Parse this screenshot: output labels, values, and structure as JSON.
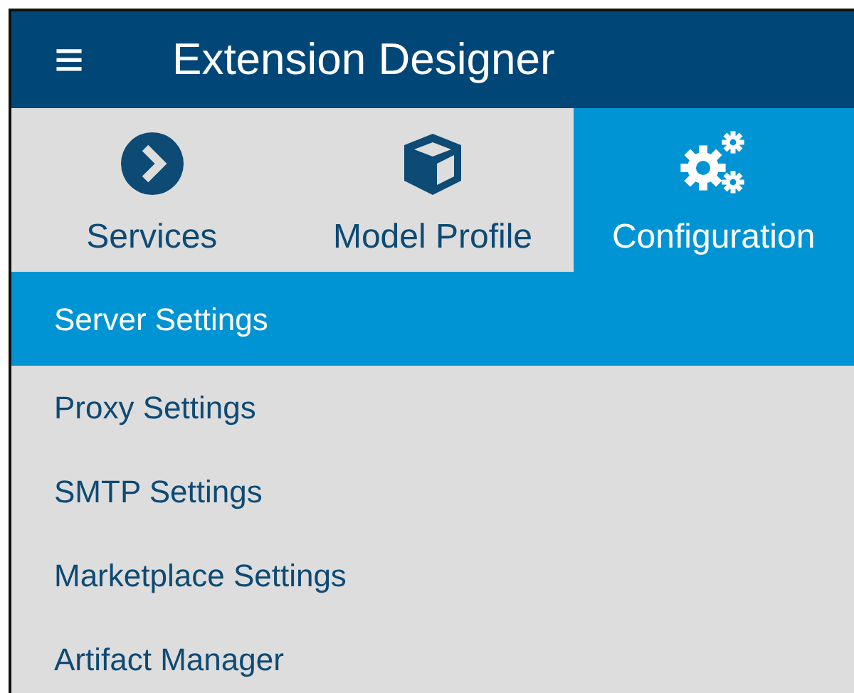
{
  "header": {
    "menu_glyph": "≡",
    "title": "Extension Designer"
  },
  "tabs": [
    {
      "label": "Services",
      "kind": "services",
      "selected": false
    },
    {
      "label": "Model Profile",
      "kind": "model",
      "selected": false
    },
    {
      "label": "Configuration",
      "kind": "config",
      "selected": true
    }
  ],
  "menu": [
    {
      "label": "Server Settings",
      "selected": true
    },
    {
      "label": "Proxy Settings",
      "selected": false
    },
    {
      "label": "SMTP Settings",
      "selected": false
    },
    {
      "label": "Marketplace Settings",
      "selected": false
    },
    {
      "label": "Artifact Manager",
      "selected": false
    }
  ]
}
